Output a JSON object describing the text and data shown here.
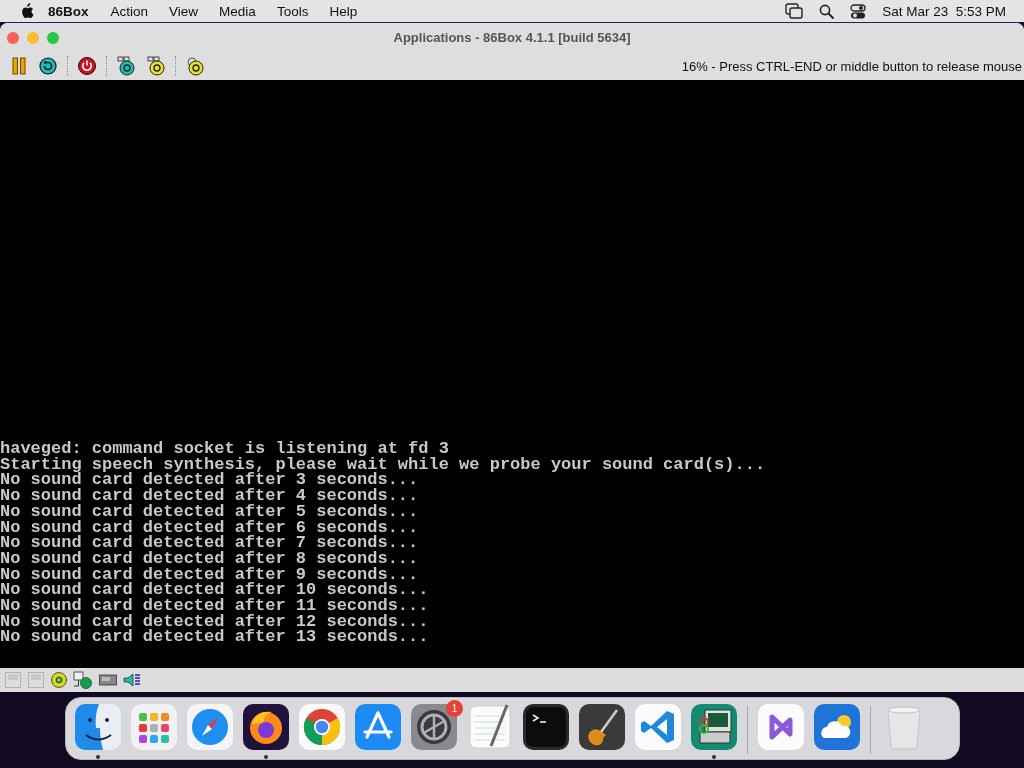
{
  "menu_bar": {
    "app_name": "86Box",
    "menus": [
      "Action",
      "View",
      "Media",
      "Tools",
      "Help"
    ],
    "clock": "Sat Mar 23  5:53 PM"
  },
  "window": {
    "title": "Applications - 86Box 4.1.1 [build 5634]",
    "toolbar_message": "16% - Press CTRL-END or middle button to release mouse",
    "console_lines": [
      "haveged: command socket is listening at fd 3",
      "Starting speech synthesis, please wait while we probe your sound card(s)...",
      "No sound card detected after 3 seconds...",
      "No sound card detected after 4 seconds...",
      "No sound card detected after 5 seconds...",
      "No sound card detected after 6 seconds...",
      "No sound card detected after 7 seconds...",
      "No sound card detected after 8 seconds...",
      "No sound card detected after 9 seconds...",
      "No sound card detected after 10 seconds...",
      "No sound card detected after 11 seconds...",
      "No sound card detected after 12 seconds...",
      "No sound card detected after 13 seconds..."
    ]
  },
  "dock": {
    "items": [
      {
        "running": true
      },
      {
        "running": false
      },
      {
        "running": false
      },
      {
        "running": true
      },
      {
        "running": false
      },
      {
        "running": false
      },
      {
        "running": false,
        "badge": "1"
      },
      {
        "running": false
      },
      {
        "running": false
      },
      {
        "running": false
      },
      {
        "running": false
      },
      {
        "running": true
      },
      {
        "running": false
      },
      {
        "running": false
      },
      {
        "running": false
      }
    ]
  }
}
